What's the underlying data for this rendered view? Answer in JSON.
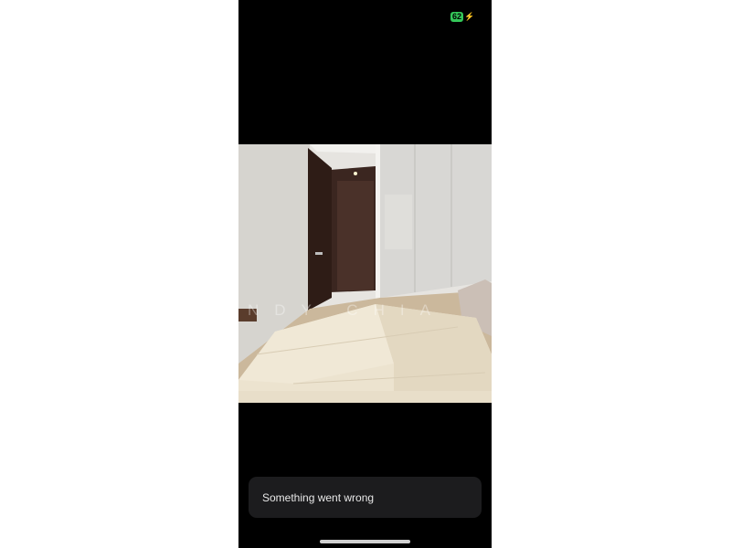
{
  "status_bar": {
    "battery_level": "62",
    "charging": true,
    "battery_color": "#34c759"
  },
  "photo": {
    "subject": "bedroom-photo",
    "watermark": "CINDY CHIA"
  },
  "toast": {
    "message": "Something went wrong"
  }
}
